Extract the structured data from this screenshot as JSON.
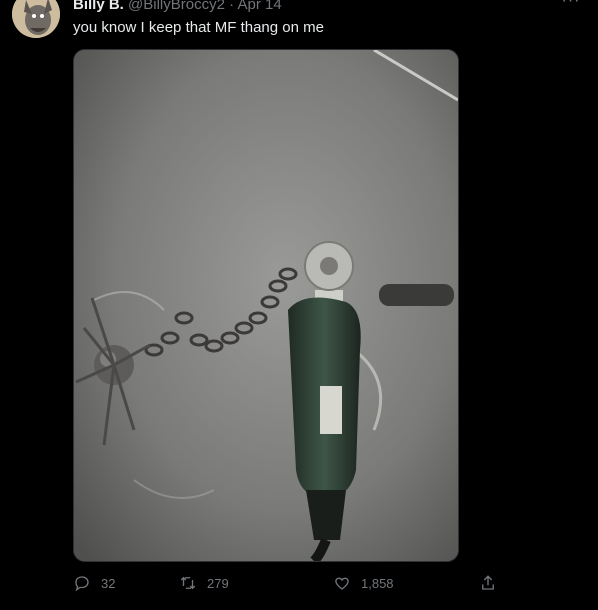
{
  "tweet": {
    "author_name": "Billy B.",
    "handle": "@BillyBroccy2",
    "separator": "·",
    "date": "Apr 14",
    "more_label": "···",
    "text": "you know I keep that MF thang on me"
  },
  "media": {
    "description_icon": "photo"
  },
  "actions": {
    "reply_count": "32",
    "retweet_count": "279",
    "like_count": "1,858"
  },
  "icons": {
    "reply": "reply-icon",
    "retweet": "retweet-icon",
    "like": "heart-icon",
    "share": "share-icon"
  },
  "colors": {
    "background": "#000000",
    "text": "#e7e9ea",
    "muted": "#71767b"
  }
}
